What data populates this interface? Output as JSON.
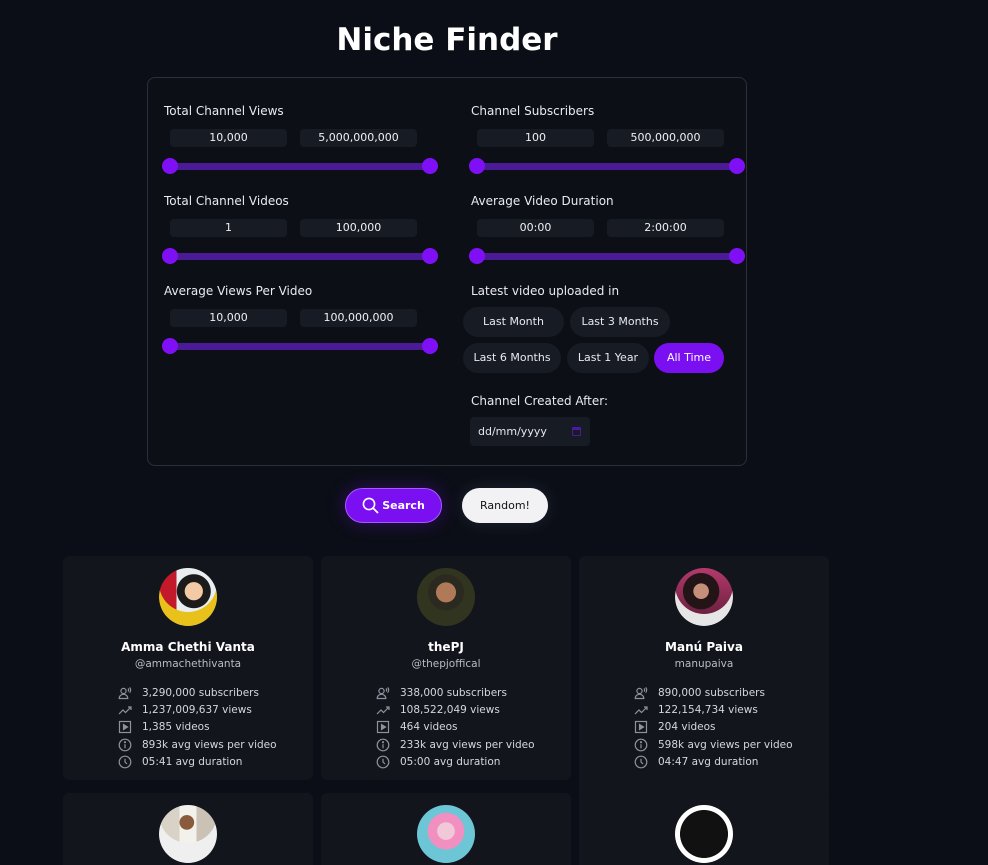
{
  "page": {
    "title": "Niche Finder"
  },
  "filters": {
    "total_channel_views": {
      "label": "Total Channel Views",
      "min": "10,000",
      "max": "5,000,000,000",
      "range": [
        0,
        1
      ]
    },
    "channel_subscribers": {
      "label": "Channel Subscribers",
      "min": "100",
      "max": "500,000,000",
      "range": [
        0,
        1
      ]
    },
    "total_channel_videos": {
      "label": "Total Channel Videos",
      "min": "1",
      "max": "100,000",
      "range": [
        0,
        1
      ]
    },
    "average_video_duration": {
      "label": "Average Video Duration",
      "min": "00:00",
      "max": "2:00:00",
      "range": [
        0,
        1
      ]
    },
    "average_views_per_video": {
      "label": "Average Views Per Video",
      "min": "10,000",
      "max": "100,000,000",
      "range": [
        0,
        1
      ]
    },
    "latest_upload": {
      "label": "Latest video uploaded in",
      "options": [
        "Last Month",
        "Last 3 Months",
        "Last 6 Months",
        "Last 1 Year",
        "All Time"
      ],
      "selected": "All Time"
    },
    "channel_created_after": {
      "label": "Channel Created After:",
      "placeholder": "dd/mm/yyyy",
      "icon": "calendar-icon"
    }
  },
  "actions": {
    "search_label": "Search",
    "search_icon": "search-icon",
    "random_label": "Random!"
  },
  "colors": {
    "accent": "#7a0ff2",
    "track": "#4a1a97",
    "background": "#0b0e16",
    "card": "#12151c"
  },
  "results": [
    {
      "name": "Amma Chethi Vanta",
      "handle": "@ammachethivanta",
      "subscribers": "3,290,000 subscribers",
      "views": "1,237,009,637 views",
      "videos": "1,385 videos",
      "avg_views": "893k avg views per video",
      "avg_duration": "05:41 avg duration"
    },
    {
      "name": "thePJ",
      "handle": "@thepjoffical",
      "subscribers": "338,000 subscribers",
      "views": "108,522,049 views",
      "videos": "464 videos",
      "avg_views": "233k avg views per video",
      "avg_duration": "05:00 avg duration"
    },
    {
      "name": "Manú Paiva",
      "handle": "manupaiva",
      "subscribers": "890,000 subscribers",
      "views": "122,154,734 views",
      "videos": "204 videos",
      "avg_views": "598k avg views per video",
      "avg_duration": "04:47 avg duration"
    },
    {
      "name": "",
      "handle": ""
    },
    {
      "name": "",
      "handle": ""
    },
    {
      "name": "",
      "handle": ""
    }
  ]
}
